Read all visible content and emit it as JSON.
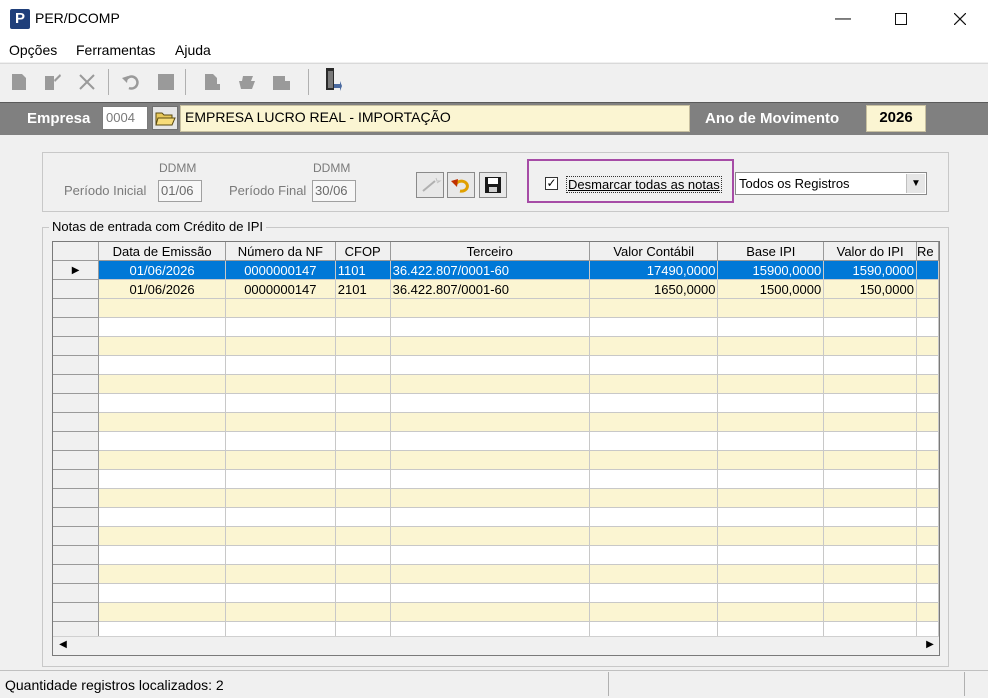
{
  "window": {
    "title": "PER/DCOMP",
    "app_icon": "P"
  },
  "menu": {
    "items": [
      "Opções",
      "Ferramentas",
      "Ajuda"
    ]
  },
  "empresa": {
    "label": "Empresa",
    "code": "0004",
    "name": "EMPRESA LUCRO REAL - IMPORTAÇÃO"
  },
  "ano": {
    "label": "Ano de Movimento",
    "value": "2026"
  },
  "filter": {
    "inicial_hdr": "DDMM",
    "inicial_label": "Período Inicial",
    "inicial_value": "01/06",
    "final_hdr": "DDMM",
    "final_label": "Período Final",
    "final_value": "30/06"
  },
  "checkbox": {
    "label": "Desmarcar todas as notas",
    "checked": true
  },
  "select": {
    "value": "Todos os Registros"
  },
  "grid": {
    "legend": "Notas de entrada com Crédito de IPI",
    "columns": [
      "Data de Emissão",
      "Número da NF",
      "CFOP",
      "Terceiro",
      "Valor Contábil",
      "Base IPI",
      "Valor do IPI",
      "Re"
    ],
    "rows": [
      [
        "01/06/2026",
        "0000000147",
        "1101",
        "36.422.807/0001-60",
        "17490,0000",
        "15900,0000",
        "1590,0000"
      ],
      [
        "01/06/2026",
        "0000000147",
        "2101",
        "36.422.807/0001-60",
        "1650,0000",
        "1500,0000",
        "150,0000"
      ]
    ]
  },
  "status": {
    "text": "Quantidade registros localizados: 2"
  }
}
